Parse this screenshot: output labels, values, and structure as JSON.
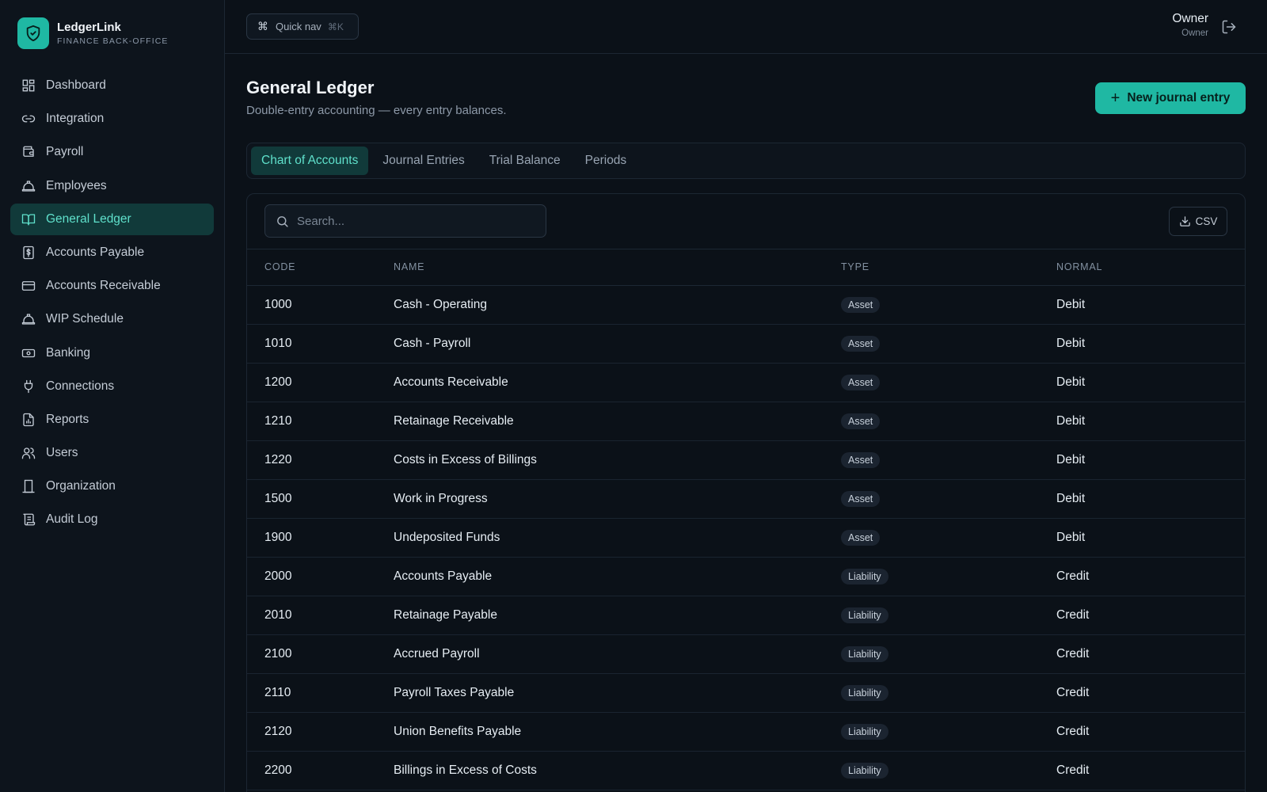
{
  "brand": {
    "name": "LedgerLink",
    "subtitle": "FINANCE BACK-OFFICE"
  },
  "sidebar": {
    "items": [
      {
        "label": "Dashboard",
        "icon": "dashboard-icon"
      },
      {
        "label": "Integration",
        "icon": "link-icon"
      },
      {
        "label": "Payroll",
        "icon": "wallet-icon"
      },
      {
        "label": "Employees",
        "icon": "hardhat-icon"
      },
      {
        "label": "General Ledger",
        "icon": "book-icon",
        "active": true
      },
      {
        "label": "Accounts Payable",
        "icon": "dollar-doc-icon"
      },
      {
        "label": "Accounts Receivable",
        "icon": "card-icon"
      },
      {
        "label": "WIP Schedule",
        "icon": "hardhat-icon"
      },
      {
        "label": "Banking",
        "icon": "banknote-icon"
      },
      {
        "label": "Connections",
        "icon": "plug-icon"
      },
      {
        "label": "Reports",
        "icon": "report-icon"
      },
      {
        "label": "Users",
        "icon": "users-icon"
      },
      {
        "label": "Organization",
        "icon": "building-icon"
      },
      {
        "label": "Audit Log",
        "icon": "scroll-icon"
      }
    ]
  },
  "topbar": {
    "quicknav_label": "Quick nav",
    "quicknav_shortcut": "⌘K",
    "user_name": "Owner",
    "user_role": "Owner"
  },
  "page": {
    "title": "General Ledger",
    "subtitle": "Double-entry accounting — every entry balances.",
    "primary_action": "New journal entry"
  },
  "tabs": [
    {
      "label": "Chart of Accounts",
      "active": true
    },
    {
      "label": "Journal Entries"
    },
    {
      "label": "Trial Balance"
    },
    {
      "label": "Periods"
    }
  ],
  "search": {
    "placeholder": "Search..."
  },
  "csv_label": "CSV",
  "table": {
    "headers": {
      "code": "CODE",
      "name": "NAME",
      "type": "TYPE",
      "normal": "NORMAL"
    },
    "rows": [
      {
        "code": "1000",
        "name": "Cash - Operating",
        "type": "Asset",
        "normal": "Debit"
      },
      {
        "code": "1010",
        "name": "Cash - Payroll",
        "type": "Asset",
        "normal": "Debit"
      },
      {
        "code": "1200",
        "name": "Accounts Receivable",
        "type": "Asset",
        "normal": "Debit"
      },
      {
        "code": "1210",
        "name": "Retainage Receivable",
        "type": "Asset",
        "normal": "Debit"
      },
      {
        "code": "1220",
        "name": "Costs in Excess of Billings",
        "type": "Asset",
        "normal": "Debit"
      },
      {
        "code": "1500",
        "name": "Work in Progress",
        "type": "Asset",
        "normal": "Debit"
      },
      {
        "code": "1900",
        "name": "Undeposited Funds",
        "type": "Asset",
        "normal": "Debit"
      },
      {
        "code": "2000",
        "name": "Accounts Payable",
        "type": "Liability",
        "normal": "Credit"
      },
      {
        "code": "2010",
        "name": "Retainage Payable",
        "type": "Liability",
        "normal": "Credit"
      },
      {
        "code": "2100",
        "name": "Accrued Payroll",
        "type": "Liability",
        "normal": "Credit"
      },
      {
        "code": "2110",
        "name": "Payroll Taxes Payable",
        "type": "Liability",
        "normal": "Credit"
      },
      {
        "code": "2120",
        "name": "Union Benefits Payable",
        "type": "Liability",
        "normal": "Credit"
      },
      {
        "code": "2200",
        "name": "Billings in Excess of Costs",
        "type": "Liability",
        "normal": "Credit"
      }
    ]
  },
  "colors": {
    "accent": "#1fb8a3",
    "accent_text": "#5fe0cb",
    "active_bg": "#113a3a",
    "background": "#0b1118"
  }
}
